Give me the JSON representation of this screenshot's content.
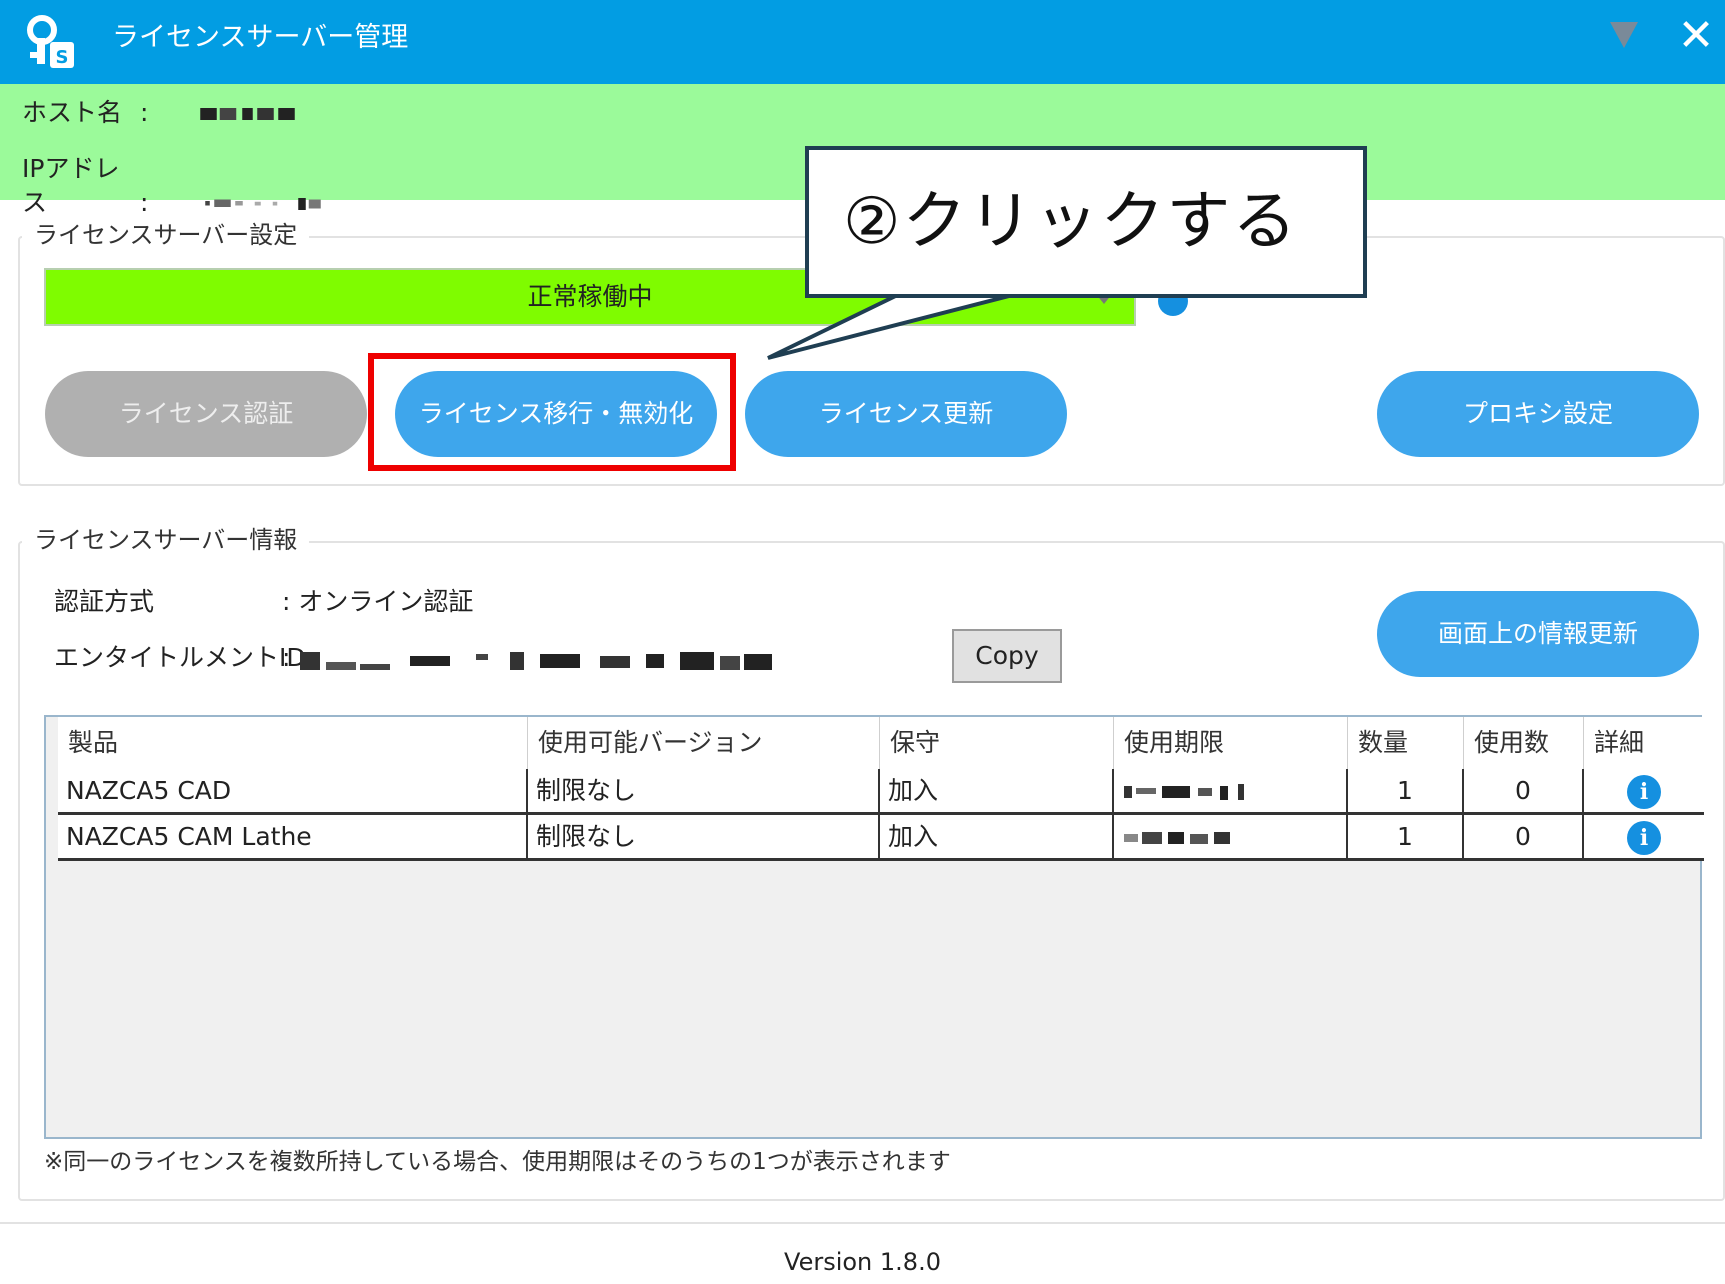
{
  "window": {
    "title": "ライセンスサーバー管理",
    "close_glyph": "✕",
    "accent_color": "#029de3"
  },
  "host_info": {
    "hostname_label": "ホスト名",
    "ip_label": "IPアドレス",
    "colon": ":"
  },
  "settings": {
    "group_title": "ライセンスサーバー設定",
    "status_text": "正常稼働中",
    "status_color": "#7ffc00",
    "buttons": {
      "license_auth": "ライセンス認証",
      "license_transfer": "ライセンス移行・無効化",
      "license_update": "ライセンス更新",
      "proxy_settings": "プロキシ設定"
    }
  },
  "callout": {
    "text": "②クリックする"
  },
  "server_info": {
    "group_title": "ライセンスサーバー情報",
    "auth_method_label": "認証方式",
    "auth_method_value": ": オンライン認証",
    "entitlement_label": "エンタイトルメントID",
    "entitlement_colon": ":",
    "copy_button": "Copy",
    "refresh_button": "画面上の情報更新"
  },
  "table": {
    "columns": [
      "製品",
      "使用可能バージョン",
      "保守",
      "使用期限",
      "数量",
      "使用数",
      "詳細"
    ],
    "rows": [
      {
        "product": "NAZCA5 CAD",
        "version": "制限なし",
        "maintenance": "加入",
        "quantity": "1",
        "used": "0",
        "detail_icon": "i"
      },
      {
        "product": "NAZCA5 CAM Lathe",
        "version": "制限なし",
        "maintenance": "加入",
        "quantity": "1",
        "used": "0",
        "detail_icon": "i"
      }
    ]
  },
  "footnote": "※同一のライセンスを複数所持している場合、使用期限はそのうちの1つが表示されます",
  "version": "Version 1.8.0",
  "icons": {
    "app": "key-license-icon",
    "dropdown": "triangle-down-icon",
    "close": "close-icon",
    "info": "info-icon"
  }
}
